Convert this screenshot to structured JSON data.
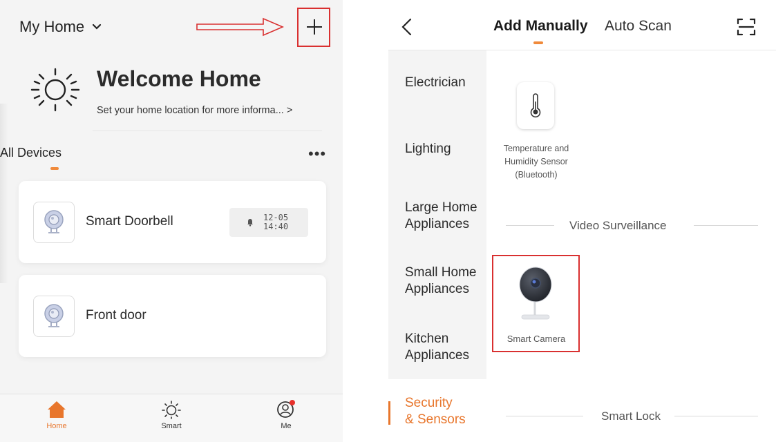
{
  "left": {
    "home_title": "My Home",
    "welcome_title": "Welcome Home",
    "welcome_subtitle": "Set your home location for more informa... >",
    "section_label": "All Devices",
    "more_label": "•••",
    "devices": [
      {
        "name": "Smart Doorbell",
        "time_date": "12-05",
        "time_clock": "14:40"
      },
      {
        "name": "Front door"
      }
    ],
    "nav": {
      "home": "Home",
      "smart": "Smart",
      "me": "Me"
    },
    "accent_color": "#e8762c",
    "highlight_color": "#d93030"
  },
  "right": {
    "tabs": {
      "manual": "Add Manually",
      "auto": "Auto Scan"
    },
    "categories": [
      "Electrician",
      "Lighting",
      "Large Home",
      "Appliances",
      "Small Home",
      "Appliances",
      "Kitchen",
      "Appliances",
      "Security",
      "& Sensors"
    ],
    "thermo_label": [
      "Temperature and",
      "Humidity Sensor",
      "(Bluetooth)"
    ],
    "section_video": "Video Surveillance",
    "camera_label": "Smart Camera",
    "section_lock": "Smart Lock"
  }
}
